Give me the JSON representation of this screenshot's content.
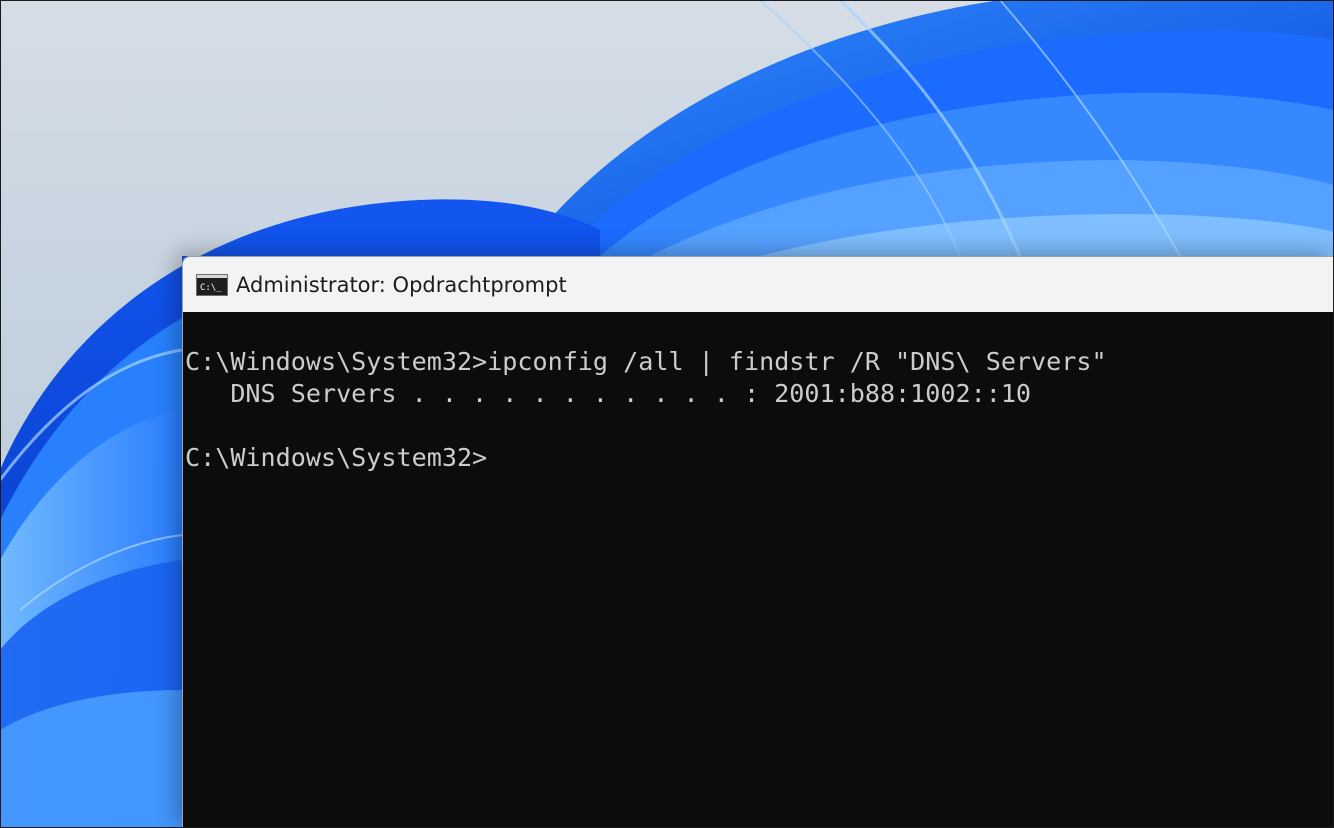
{
  "window": {
    "title": "Administrator: Opdrachtprompt",
    "icon": "cmd-icon"
  },
  "console": {
    "lines": [
      "C:\\Windows\\System32>ipconfig /all | findstr /R \"DNS\\ Servers\"",
      "   DNS Servers . . . . . . . . . . . : 2001:b88:1002::10",
      "",
      "C:\\Windows\\System32>"
    ]
  },
  "colors": {
    "console_bg": "#0c0c0c",
    "console_text": "#cccccc",
    "titlebar_bg": "#f3f3f3",
    "wallpaper_blue": "#1a6cff"
  }
}
